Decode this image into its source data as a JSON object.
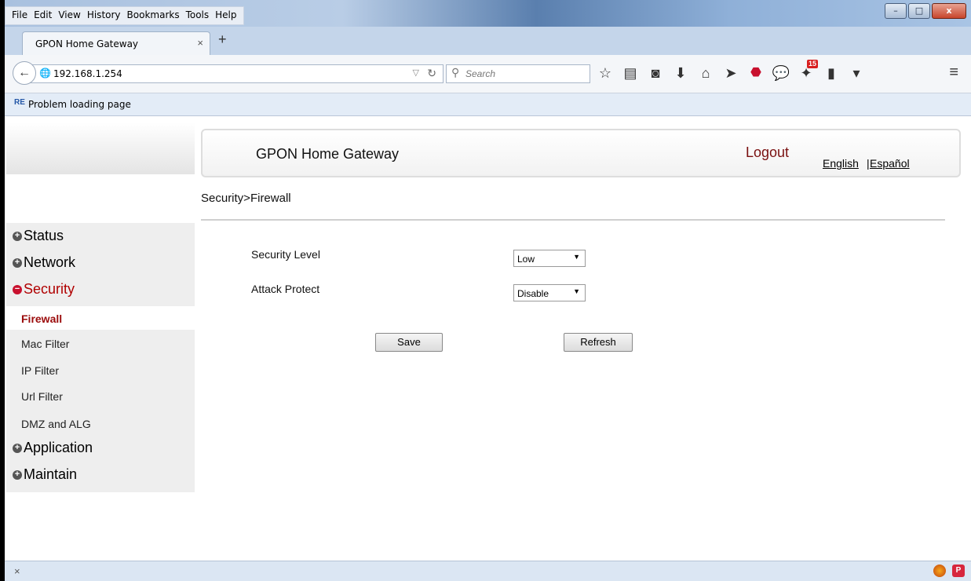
{
  "browser": {
    "menu": [
      "File",
      "Edit",
      "View",
      "History",
      "Bookmarks",
      "Tools",
      "Help"
    ],
    "tab_title": "GPON Home Gateway",
    "tab_close": "×",
    "new_tab": "+",
    "url": "192.168.1.254",
    "search_placeholder": "Search",
    "bookmark_icon": "RE",
    "bookmark_label": "Problem loading page",
    "notification_badge": "15",
    "status_close": "×",
    "window_controls": {
      "minimize": "–",
      "maximize": "□",
      "close": "x"
    }
  },
  "header": {
    "brand": "GPON Home Gateway",
    "logout": "Logout",
    "lang_en": "English",
    "lang_sep": "|",
    "lang_es": "Español"
  },
  "breadcrumb": "Security>Firewall",
  "sidebar": {
    "groups": {
      "status": "Status",
      "network": "Network",
      "security": "Security",
      "application": "Application",
      "maintain": "Maintain"
    },
    "security_items": [
      "Firewall",
      "Mac Filter",
      "IP Filter",
      "Url Filter",
      "DMZ and ALG"
    ]
  },
  "form": {
    "security_level_label": "Security Level",
    "security_level_value": "Low",
    "attack_protect_label": "Attack Protect",
    "attack_protect_value": "Disable",
    "save": "Save",
    "refresh": "Refresh"
  },
  "colors": {
    "accent": "#b00000",
    "logout": "#7a1010"
  }
}
